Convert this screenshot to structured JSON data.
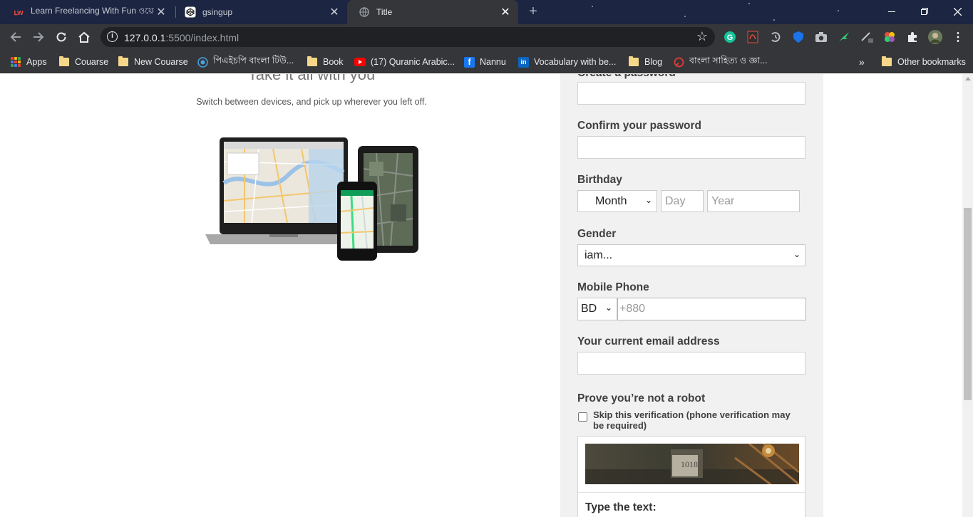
{
  "browser": {
    "tabs": [
      {
        "title": "Learn Freelancing With Fun ওয়েব",
        "favicon": "lwf-logo-icon",
        "active": false
      },
      {
        "title": "gsingup",
        "favicon": "codepen-icon",
        "active": false
      },
      {
        "title": "Title",
        "favicon": "globe-icon",
        "active": true
      }
    ],
    "new_tab_symbol": "+",
    "url_host": "127.0.0.1",
    "url_path": ":5500/index.html",
    "bookmarks": [
      {
        "label": "Apps",
        "icon": "apps-grid-icon"
      },
      {
        "label": "Couarse",
        "icon": "folder-icon"
      },
      {
        "label": "New Couarse",
        "icon": "folder-icon"
      },
      {
        "label": "পিএইচপি বাংলা টিউ...",
        "icon": "site-icon"
      },
      {
        "label": "Book",
        "icon": "folder-icon"
      },
      {
        "label": "(17) Quranic Arabic...",
        "icon": "youtube-icon"
      },
      {
        "label": "Nannu",
        "icon": "facebook-icon"
      },
      {
        "label": "Vocabulary with be...",
        "icon": "linkedin-icon"
      },
      {
        "label": "Blog",
        "icon": "folder-icon"
      },
      {
        "label": "বাংলা সাহিত্য ও জ্ঞা...",
        "icon": "site-icon"
      }
    ],
    "more_bookmarks": "»",
    "other_bookmarks": "Other bookmarks"
  },
  "left": {
    "title": "Take it all with you",
    "subtitle": "Switch between devices, and pick up wherever you left off."
  },
  "form": {
    "create_password_label": "Create a password",
    "confirm_password_label": "Confirm your password",
    "birthday_label": "Birthday",
    "month_selected": "Month",
    "day_placeholder": "Day",
    "year_placeholder": "Year",
    "gender_label": "Gender",
    "gender_selected": "iam...",
    "mobile_label": "Mobile Phone",
    "country_selected": "BD",
    "phone_placeholder": "+880",
    "email_label": "Your current email address",
    "robot_label": "Prove you’re not a robot",
    "skip_label": "Skip this verification (phone verification may be required)",
    "captcha_number": "1018",
    "type_text_label": "Type the text:"
  },
  "colors": {
    "chrome_dark": "#1c2541",
    "toolbar": "#35363a",
    "form_bg": "#f1f1f1"
  }
}
